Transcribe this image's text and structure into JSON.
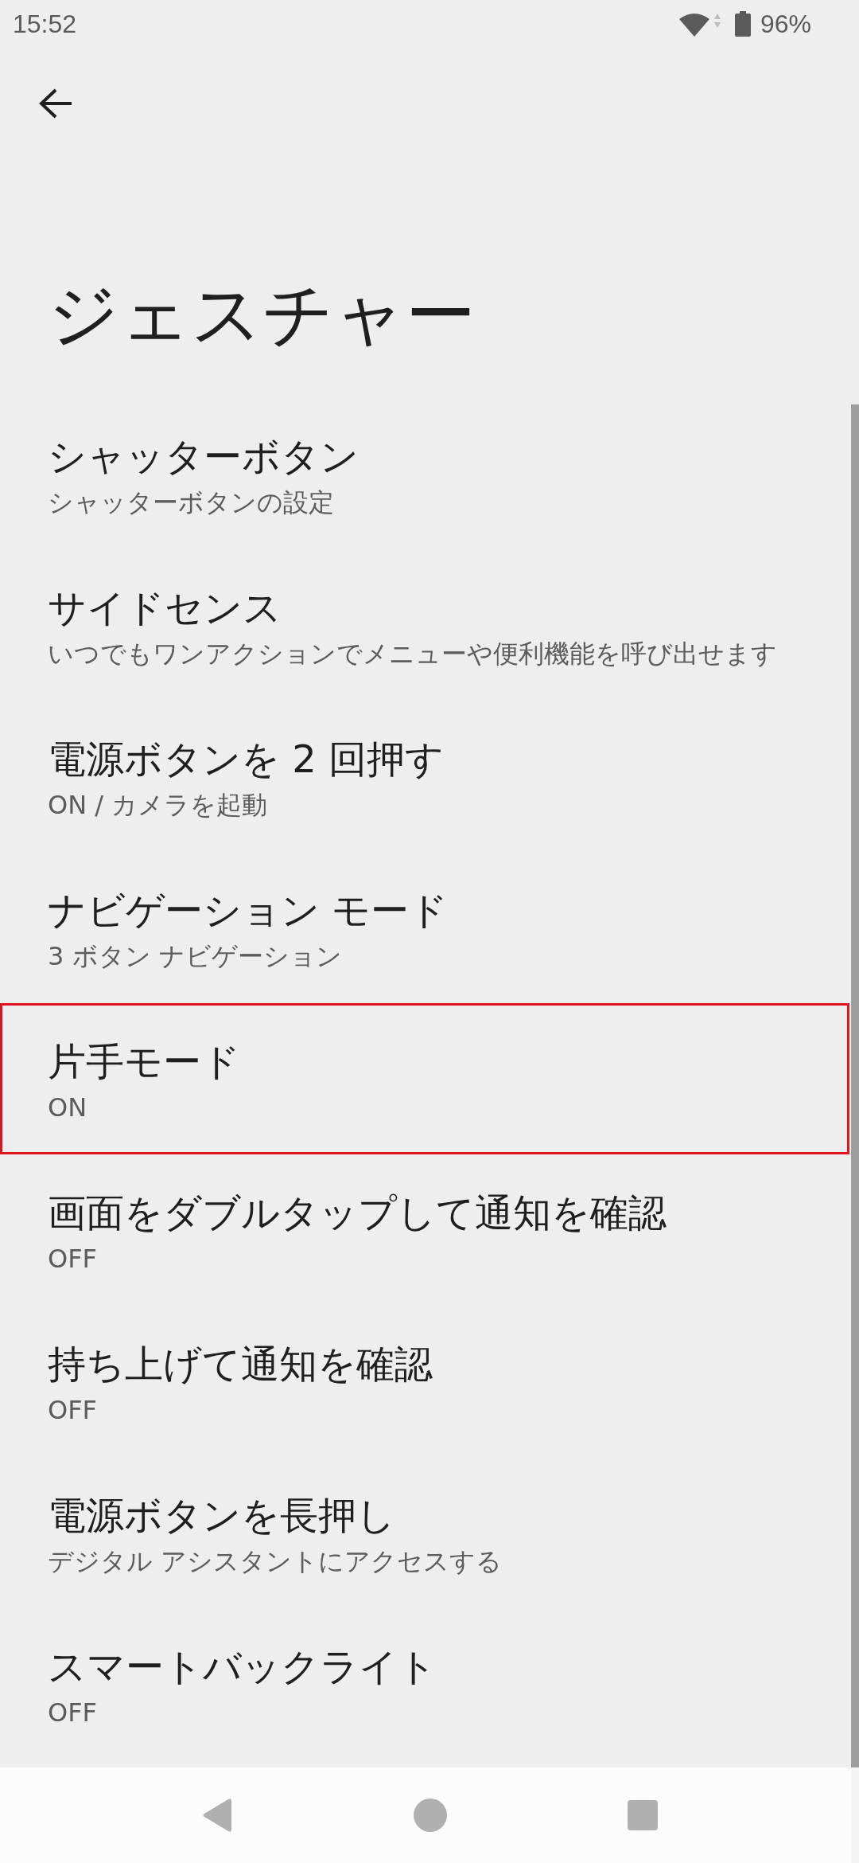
{
  "status_bar": {
    "time": "15:52",
    "battery": "96%"
  },
  "title": "ジェスチャー",
  "items": [
    {
      "title": "シャッターボタン",
      "subtitle": "シャッターボタンの設定",
      "highlighted": false
    },
    {
      "title": "サイドセンス",
      "subtitle": "いつでもワンアクションでメニューや便利機能を呼び出せます",
      "highlighted": false
    },
    {
      "title": "電源ボタンを 2 回押す",
      "subtitle": "ON / カメラを起動",
      "highlighted": false
    },
    {
      "title": "ナビゲーション モード",
      "subtitle": "3 ボタン ナビゲーション",
      "highlighted": false
    },
    {
      "title": "片手モード",
      "subtitle": "ON",
      "highlighted": true
    },
    {
      "title": "画面をダブルタップして通知を確認",
      "subtitle": "OFF",
      "highlighted": false
    },
    {
      "title": "持ち上げて通知を確認",
      "subtitle": "OFF",
      "highlighted": false
    },
    {
      "title": "電源ボタンを長押し",
      "subtitle": "デジタル アシスタントにアクセスする",
      "highlighted": false
    },
    {
      "title": "スマートバックライト",
      "subtitle": "OFF",
      "highlighted": false
    }
  ]
}
